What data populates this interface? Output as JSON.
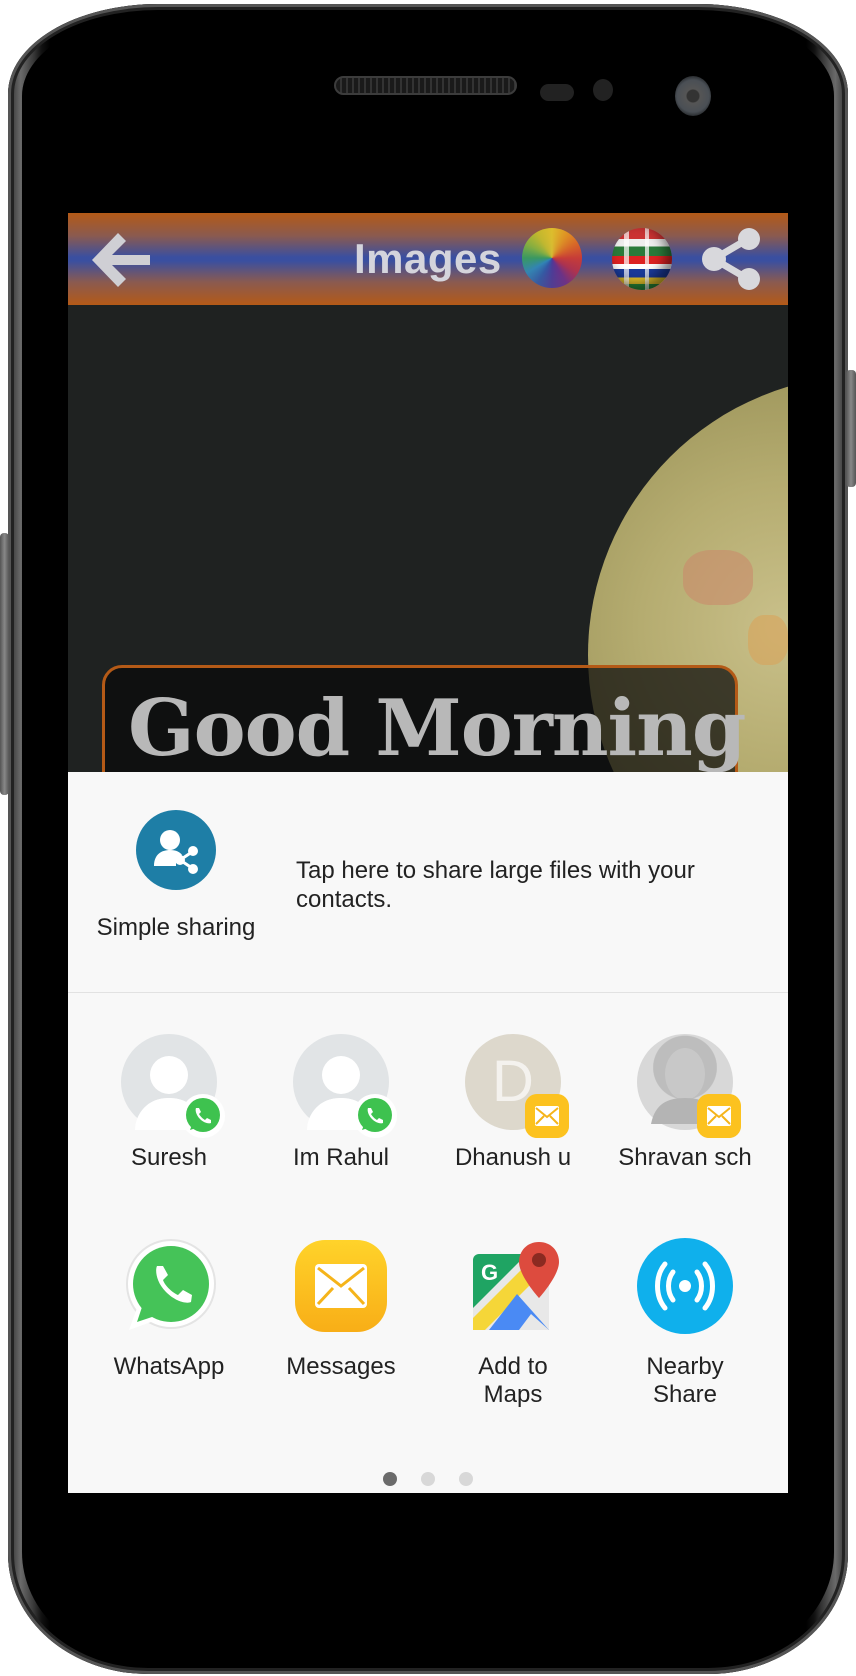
{
  "device": {
    "frame": "android-phone-mockup"
  },
  "toolbar": {
    "title": "Images",
    "back_icon": "arrow-left-icon",
    "color_wheel_icon": "color-wheel-icon",
    "language_icon": "flag-globe-icon",
    "share_icon": "share-icon",
    "colors": {
      "top_bottom": "#b45a17",
      "middle": "#3a4fa0"
    }
  },
  "content": {
    "greeting_text": "Good Morning",
    "background": "dark photo with antique globe"
  },
  "share_sheet": {
    "simple_sharing": {
      "label": "Simple sharing",
      "description": "Tap here to share large files with your contacts.",
      "icon": "contact-share-icon",
      "color": "#1e7ea6"
    },
    "contacts": [
      {
        "name": "Suresh",
        "avatar": "default",
        "via": "whatsapp"
      },
      {
        "name": "Im Rahul",
        "avatar": "default",
        "via": "whatsapp"
      },
      {
        "name": "Dhanush u",
        "avatar": "initial",
        "initial": "D",
        "via": "messages"
      },
      {
        "name": "Shravan sch",
        "avatar": "photo",
        "via": "messages"
      }
    ],
    "apps": [
      {
        "label": "WhatsApp",
        "icon": "whatsapp-icon"
      },
      {
        "label": "Messages",
        "icon": "messages-icon"
      },
      {
        "label": "Add to Maps",
        "icon": "google-maps-icon"
      },
      {
        "label": "Nearby Share",
        "icon": "nearby-share-icon"
      }
    ],
    "pagination": {
      "pages": 3,
      "current": 1
    }
  }
}
